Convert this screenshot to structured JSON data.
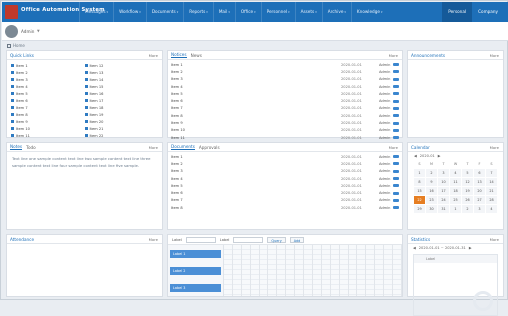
{
  "app": {
    "title": "Office Automation System",
    "user": "Admin"
  },
  "nav": [
    {
      "label": "Messages"
    },
    {
      "label": "Workflow"
    },
    {
      "label": "Documents"
    },
    {
      "label": "Reports"
    },
    {
      "label": "Mail"
    },
    {
      "label": "Office"
    },
    {
      "label": "Personnel"
    },
    {
      "label": "Assets"
    },
    {
      "label": "Archive"
    },
    {
      "label": "Knowledge"
    }
  ],
  "header_right": [
    {
      "label": "Personal"
    },
    {
      "label": "Company"
    }
  ],
  "breadcrumb": {
    "label": "Home"
  },
  "panels": {
    "quick_links": {
      "title": "Quick Links",
      "more": "More",
      "col1": [
        "Item 1",
        "Item 2",
        "Item 3",
        "Item 4",
        "Item 5",
        "Item 6",
        "Item 7",
        "Item 8",
        "Item 9",
        "Item 10",
        "Item 11"
      ],
      "col2": [
        "Item 12",
        "Item 13",
        "Item 14",
        "Item 15",
        "Item 16",
        "Item 17",
        "Item 18",
        "Item 19",
        "Item 20",
        "Item 21",
        "Item 22"
      ]
    },
    "news": {
      "tabs": [
        "Notices",
        "News"
      ],
      "more": "More",
      "rows": [
        {
          "t": "Item 1",
          "d": "2020-01-01",
          "a": "Admin"
        },
        {
          "t": "Item 2",
          "d": "2020-01-01",
          "a": "Admin"
        },
        {
          "t": "Item 3",
          "d": "2020-01-01",
          "a": "Admin"
        },
        {
          "t": "Item 4",
          "d": "2020-01-01",
          "a": "Admin"
        },
        {
          "t": "Item 5",
          "d": "2020-01-01",
          "a": "Admin"
        },
        {
          "t": "Item 6",
          "d": "2020-01-01",
          "a": "Admin"
        },
        {
          "t": "Item 7",
          "d": "2020-01-01",
          "a": "Admin"
        },
        {
          "t": "Item 8",
          "d": "2020-01-01",
          "a": "Admin"
        },
        {
          "t": "Item 9",
          "d": "2020-01-01",
          "a": "Admin"
        },
        {
          "t": "Item 10",
          "d": "2020-01-01",
          "a": "Admin"
        },
        {
          "t": "Item 11",
          "d": "2020-01-01",
          "a": "Admin"
        }
      ]
    },
    "right_top": {
      "title": "Announcements",
      "more": "More"
    },
    "left_mid": {
      "tabs": [
        "Notes",
        "Todo"
      ],
      "more": "More",
      "text": "Text line one sample content text line two sample content text line three sample content text line four sample content text line five sample."
    },
    "center_mid": {
      "tabs": [
        "Documents",
        "Approvals"
      ],
      "more": "More",
      "rows": [
        {
          "t": "Item 1",
          "d": "2020-01-01",
          "a": "Admin"
        },
        {
          "t": "Item 2",
          "d": "2020-01-01",
          "a": "Admin"
        },
        {
          "t": "Item 3",
          "d": "2020-01-01",
          "a": "Admin"
        },
        {
          "t": "Item 4",
          "d": "2020-01-01",
          "a": "Admin"
        },
        {
          "t": "Item 5",
          "d": "2020-01-01",
          "a": "Admin"
        },
        {
          "t": "Item 6",
          "d": "2020-01-01",
          "a": "Admin"
        },
        {
          "t": "Item 7",
          "d": "2020-01-01",
          "a": "Admin"
        },
        {
          "t": "Item 8",
          "d": "2020-01-01",
          "a": "Admin"
        }
      ]
    },
    "calendar": {
      "title": "Calendar",
      "more": "More",
      "month": "2020-01",
      "weekdays": [
        "S",
        "M",
        "T",
        "W",
        "T",
        "F",
        "S"
      ],
      "days": [
        "1",
        "2",
        "3",
        "4",
        "5",
        "6",
        "7",
        "8",
        "9",
        "10",
        "11",
        "12",
        "13",
        "14",
        "15",
        "16",
        "17",
        "18",
        "19",
        "20",
        "21",
        "22",
        "23",
        "24",
        "25",
        "26",
        "27",
        "28",
        "29",
        "30",
        "31",
        "1",
        "2",
        "3",
        "4"
      ],
      "today_index": 21
    },
    "left_bottom": {
      "title": "Attendance",
      "more": "More"
    },
    "schedule": {
      "label_a": "Label",
      "label_b": "Label",
      "btn_a": "Query",
      "btn_b": "Add",
      "tags": [
        "Label 1",
        "Label 2",
        "Label 3",
        "Label 4"
      ]
    },
    "right_bottom": {
      "title": "Statistics",
      "more": "More",
      "range": "2020-01-01 ~ 2020-01-31",
      "col": "Label"
    }
  }
}
